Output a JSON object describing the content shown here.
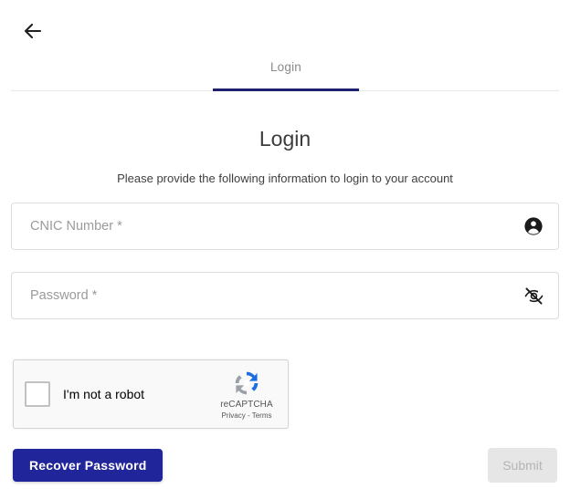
{
  "header": {
    "back_icon": "arrow-left-icon"
  },
  "tabs": [
    {
      "label": "Login",
      "active": true
    }
  ],
  "main": {
    "title": "Login",
    "subtitle": "Please provide the following information to login to your account"
  },
  "form": {
    "cnic": {
      "placeholder": "CNIC Number *",
      "value": "",
      "icon": "account-circle-icon"
    },
    "password": {
      "placeholder": "Password *",
      "value": "",
      "icon": "visibility-off-icon"
    }
  },
  "recaptcha": {
    "checkbox_label": "I'm not a robot",
    "brand": "reCAPTCHA",
    "legal": "Privacy - Terms",
    "checked": false
  },
  "actions": {
    "recover_label": "Recover Password",
    "submit_label": "Submit",
    "submit_disabled": true
  },
  "colors": {
    "accent": "#21259a",
    "tab_underline": "#1e2171",
    "field_border": "#dcdcdc",
    "disabled_bg": "#e6e6e6",
    "disabled_text": "#b4b4b4",
    "recaptcha_bg": "#f9f9f9",
    "recaptcha_blue": "#1c6ee0",
    "recaptcha_gray": "#9aa0a6"
  }
}
